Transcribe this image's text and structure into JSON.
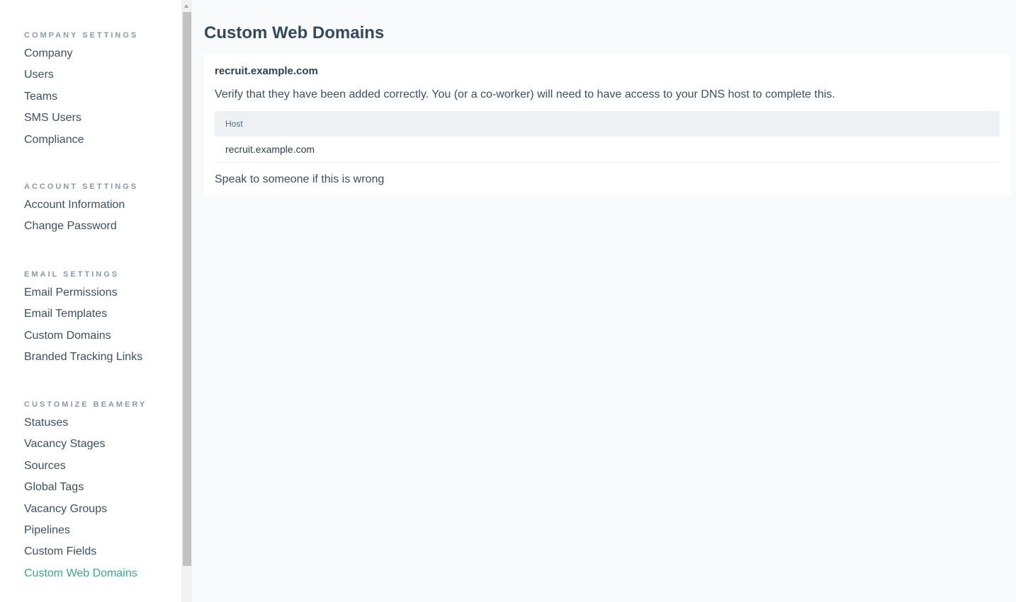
{
  "sidebar": {
    "sections": [
      {
        "heading": "COMPANY SETTINGS",
        "items": [
          "Company",
          "Users",
          "Teams",
          "SMS Users",
          "Compliance"
        ]
      },
      {
        "heading": "ACCOUNT SETTINGS",
        "items": [
          "Account Information",
          "Change Password"
        ]
      },
      {
        "heading": "EMAIL SETTINGS",
        "items": [
          "Email Permissions",
          "Email Templates",
          "Custom Domains",
          "Branded Tracking Links"
        ]
      },
      {
        "heading": "CUSTOMIZE BEAMERY",
        "items": [
          "Statuses",
          "Vacancy Stages",
          "Sources",
          "Global Tags",
          "Vacancy Groups",
          "Pipelines",
          "Custom Fields",
          "Custom Web Domains"
        ]
      }
    ],
    "active_item": "Custom Web Domains"
  },
  "main": {
    "title": "Custom Web Domains",
    "card": {
      "domain": "recruit.example.com",
      "description": "Verify that they have been added correctly. You (or a co-worker) will need to have access to your DNS host to complete this.",
      "table": {
        "headers": [
          "Host"
        ],
        "rows": [
          [
            "recruit.example.com"
          ]
        ]
      },
      "help_link": "Speak to someone if this is wrong"
    }
  },
  "colors": {
    "accent": "#3aaa8b",
    "heading": "#34495e",
    "section_heading": "#8a9aa8",
    "table_header_bg": "#edf1f4",
    "main_bg": "#f9fafc"
  }
}
